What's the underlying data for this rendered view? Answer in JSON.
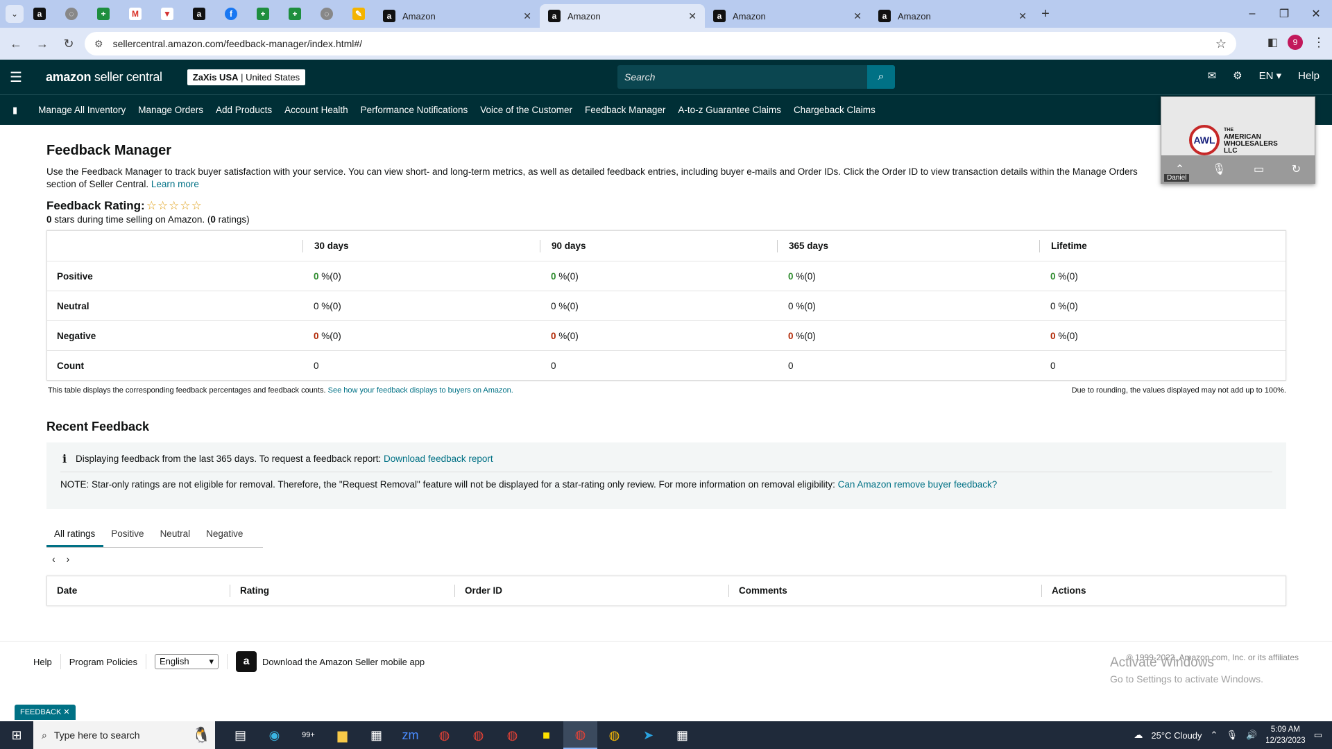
{
  "browser": {
    "tabs": [
      {
        "title": "Amazon",
        "active": false
      },
      {
        "title": "Amazon",
        "active": true
      },
      {
        "title": "Amazon",
        "active": false
      },
      {
        "title": "Amazon",
        "active": false
      }
    ],
    "url": "sellercentral.amazon.com/feedback-manager/index.html#/",
    "profile_initial": "9"
  },
  "header": {
    "logo_bold": "amazon",
    "logo_rest": " seller central",
    "account_bold": "ZaXis USA",
    "account_region": " | United States",
    "search_placeholder": "Search",
    "language": "EN",
    "help": "Help"
  },
  "nav": {
    "items": [
      "Manage All Inventory",
      "Manage Orders",
      "Add Products",
      "Account Health",
      "Performance Notifications",
      "Voice of the Customer",
      "Feedback Manager",
      "A-to-z Guarantee Claims",
      "Chargeback Claims"
    ]
  },
  "video": {
    "logo_text": "AWL",
    "company_small": "THE",
    "company_l1": "AMERICAN",
    "company_l2": "WHOLESALERS",
    "company_l3": "LLC",
    "participant": "Daniel"
  },
  "page": {
    "title": "Feedback Manager",
    "description": "Use the Feedback Manager to track buyer satisfaction with your service. You can view short- and long-term metrics, as well as detailed feedback entries, including buyer e-mails and Order IDs. Click the Order ID to view transaction details within the Manage Orders section of Seller Central.",
    "learn_more": "Learn more",
    "rating_heading": "Feedback Rating:",
    "stars": "☆☆☆☆☆",
    "rating_count_value": "0",
    "rating_sub_mid": " stars during time selling on Amazon. (",
    "rating_ratings_value": "0",
    "rating_sub_end": " ratings)"
  },
  "feedback_table": {
    "columns": [
      "30 days",
      "90 days",
      "365 days",
      "Lifetime"
    ],
    "rows": [
      {
        "label": "Positive",
        "cells": [
          "0",
          "0",
          "0",
          "0"
        ],
        "suffix": " %(0)"
      },
      {
        "label": "Neutral",
        "cells": [
          "0",
          "0",
          "0",
          "0"
        ],
        "suffix": " %(0)"
      },
      {
        "label": "Negative",
        "cells": [
          "0",
          "0",
          "0",
          "0"
        ],
        "suffix": " %(0)"
      },
      {
        "label": "Count",
        "cells": [
          "0",
          "0",
          "0",
          "0"
        ],
        "suffix": ""
      }
    ],
    "note_left": "This table displays the corresponding feedback percentages and feedback counts.",
    "note_link": "See how your feedback displays to buyers on Amazon.",
    "note_right": "Due to rounding, the values displayed may not add up to 100%."
  },
  "recent": {
    "title": "Recent Feedback",
    "info_text": "Displaying feedback from the last 365 days. To request a feedback report:",
    "info_link": "Download feedback report",
    "note_text": "NOTE: Star-only ratings are not eligible for removal. Therefore, the \"Request Removal\" feature will not be displayed for a star-rating only review. For more information on removal eligibility:",
    "note_link": "Can Amazon remove buyer feedback?",
    "tabs": [
      "All ratings",
      "Positive",
      "Neutral",
      "Negative"
    ],
    "columns": [
      "Date",
      "Rating",
      "Order ID",
      "Comments",
      "Actions"
    ]
  },
  "footer": {
    "help": "Help",
    "policies": "Program Policies",
    "language": "English",
    "app_text": "Download the Amazon Seller mobile app",
    "copyright": "© 1999-2023, Amazon.com, Inc. or its affiliates",
    "activate_title": "Activate Windows",
    "activate_sub": "Go to Settings to activate Windows.",
    "feedback_button": "FEEDBACK"
  },
  "taskbar": {
    "search_placeholder": "Type here to search",
    "mail_badge": "99+",
    "weather": "25°C  Cloudy",
    "time": "5:09 AM",
    "date": "12/23/2023"
  },
  "colors": {
    "header_bg": "#002f36",
    "link": "#007185",
    "positive": "#2e8b2e",
    "negative": "#b12704"
  }
}
